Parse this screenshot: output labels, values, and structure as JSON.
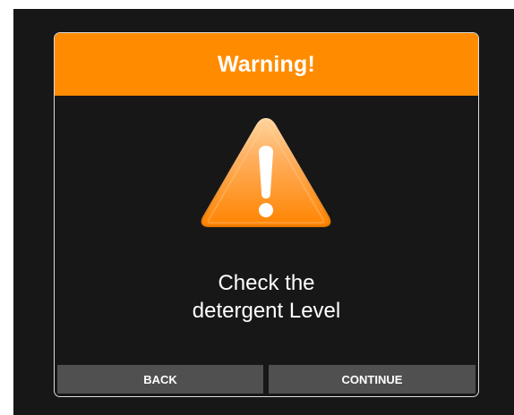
{
  "dialog": {
    "title": "Warning!",
    "icon": "warning-triangle-icon",
    "message_line_1": "Check the",
    "message_line_2": "detergent Level",
    "buttons": {
      "back": "BACK",
      "continue": "CONTINUE"
    }
  },
  "colors": {
    "accent": "#ff8c00",
    "background": "#171717",
    "button": "#505050",
    "text": "#ffffff",
    "border": "#dcdcdc"
  }
}
